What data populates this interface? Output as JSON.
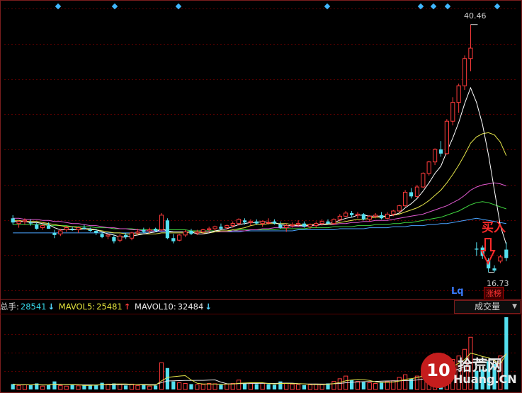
{
  "volume_header": {
    "total_label": "总手:",
    "total_value": "28541",
    "mavol5_label": "MAVOL5:",
    "mavol5_value": "25481",
    "mavol10_label": "MAVOL10:",
    "mavol10_value": "32484",
    "mode_select": "成交量"
  },
  "annotations": {
    "buy_label": "买入",
    "lq_label": "Lq",
    "zhangbang_label": "涨榜",
    "high_price": "40.46",
    "low_price": "16.73"
  },
  "watermark": {
    "logo": "10",
    "cn": "拾荒网",
    "en": "Huang.CN"
  },
  "colors": {
    "background": "#000000",
    "up_candle": "#ff3b3b",
    "down_candle": "#54e0f0",
    "grid": "#5a0000",
    "ma5": "#ffffff",
    "ma10": "#e6e64a",
    "ma20": "#e05ad0",
    "ma30": "#3fd43f",
    "ma60": "#4aa3ff"
  },
  "chart_data": [
    {
      "type": "candlestick",
      "title": "",
      "xlabel": "",
      "ylabel": "",
      "ylim": [
        15,
        42
      ],
      "grid": true,
      "x": [
        1,
        2,
        3,
        4,
        5,
        6,
        7,
        8,
        9,
        10,
        11,
        12,
        13,
        14,
        15,
        16,
        17,
        18,
        19,
        20,
        21,
        22,
        23,
        24,
        25,
        26,
        27,
        28,
        29,
        30,
        31,
        32,
        33,
        34,
        35,
        36,
        37,
        38,
        39,
        40,
        41,
        42,
        43,
        44,
        45,
        46,
        47,
        48,
        49,
        50,
        51,
        52,
        53,
        54,
        55,
        56,
        57,
        58,
        59,
        60,
        61,
        62,
        63,
        64,
        65,
        66,
        67,
        68,
        69,
        70,
        71,
        72,
        73,
        74,
        75,
        76,
        77,
        78,
        79,
        80,
        81,
        82,
        83,
        84
      ],
      "ohlc": [
        [
          21.9,
          22.2,
          21.3,
          21.5
        ],
        [
          21.4,
          21.7,
          21.0,
          21.6
        ],
        [
          21.6,
          21.9,
          21.3,
          21.7
        ],
        [
          21.5,
          21.8,
          21.2,
          21.4
        ],
        [
          21.3,
          21.5,
          20.8,
          20.9
        ],
        [
          21.0,
          21.4,
          20.8,
          21.2
        ],
        [
          21.2,
          21.5,
          20.9,
          20.9
        ],
        [
          20.5,
          20.8,
          20.0,
          20.3
        ],
        [
          20.4,
          20.9,
          20.2,
          20.7
        ],
        [
          20.8,
          21.2,
          20.6,
          21.0
        ],
        [
          20.9,
          21.1,
          20.7,
          20.8
        ],
        [
          20.8,
          21.1,
          20.5,
          21.0
        ],
        [
          21.0,
          21.3,
          20.8,
          20.9
        ],
        [
          20.8,
          21.0,
          20.6,
          20.7
        ],
        [
          20.7,
          20.9,
          20.3,
          20.5
        ],
        [
          20.4,
          20.6,
          20.0,
          20.1
        ],
        [
          20.2,
          20.4,
          19.9,
          20.3
        ],
        [
          20.1,
          20.3,
          19.5,
          19.7
        ],
        [
          19.8,
          20.4,
          19.6,
          20.2
        ],
        [
          20.3,
          20.5,
          19.9,
          20.1
        ],
        [
          20.0,
          20.6,
          19.8,
          20.5
        ],
        [
          20.5,
          20.9,
          20.3,
          20.6
        ],
        [
          20.8,
          21.0,
          20.5,
          20.6
        ],
        [
          20.7,
          21.0,
          20.5,
          20.8
        ],
        [
          20.9,
          21.0,
          20.6,
          20.7
        ],
        [
          20.8,
          22.4,
          20.7,
          22.2
        ],
        [
          21.7,
          21.9,
          19.9,
          20.0
        ],
        [
          20.0,
          20.4,
          19.5,
          19.7
        ],
        [
          19.8,
          20.4,
          19.7,
          20.3
        ],
        [
          20.3,
          20.8,
          20.1,
          20.6
        ],
        [
          20.7,
          20.9,
          20.3,
          20.4
        ],
        [
          20.5,
          20.8,
          20.3,
          20.6
        ],
        [
          20.6,
          20.9,
          20.4,
          20.8
        ],
        [
          20.8,
          21.1,
          20.6,
          20.9
        ],
        [
          20.9,
          21.2,
          20.7,
          21.1
        ],
        [
          21.1,
          21.4,
          20.8,
          20.9
        ],
        [
          21.0,
          21.3,
          20.8,
          21.2
        ],
        [
          21.2,
          21.6,
          21.0,
          21.4
        ],
        [
          21.4,
          21.9,
          21.2,
          21.8
        ],
        [
          21.7,
          21.9,
          21.3,
          21.5
        ],
        [
          21.5,
          21.8,
          21.2,
          21.6
        ],
        [
          21.6,
          21.8,
          21.3,
          21.4
        ],
        [
          21.4,
          21.7,
          21.1,
          21.6
        ],
        [
          21.5,
          21.9,
          21.3,
          21.5
        ],
        [
          21.6,
          21.8,
          21.3,
          21.4
        ],
        [
          21.3,
          21.6,
          20.9,
          21.0
        ],
        [
          21.0,
          21.4,
          20.6,
          21.2
        ],
        [
          21.2,
          21.5,
          21.0,
          21.3
        ],
        [
          21.3,
          21.7,
          21.1,
          21.4
        ],
        [
          21.4,
          21.6,
          21.0,
          21.1
        ],
        [
          21.1,
          21.4,
          20.9,
          21.3
        ],
        [
          21.2,
          21.6,
          21.0,
          21.4
        ],
        [
          21.4,
          21.8,
          21.2,
          21.6
        ],
        [
          21.6,
          21.8,
          21.3,
          21.4
        ],
        [
          21.4,
          21.9,
          21.3,
          21.8
        ],
        [
          21.8,
          22.3,
          21.6,
          22.1
        ],
        [
          22.1,
          22.6,
          22.0,
          22.4
        ],
        [
          22.4,
          22.6,
          22.0,
          22.2
        ],
        [
          22.2,
          22.5,
          21.9,
          22.3
        ],
        [
          22.3,
          22.4,
          21.7,
          21.8
        ],
        [
          21.8,
          22.2,
          21.6,
          22.1
        ],
        [
          22.1,
          22.4,
          21.9,
          22.2
        ],
        [
          22.2,
          22.5,
          21.8,
          21.9
        ],
        [
          21.9,
          22.5,
          21.8,
          22.3
        ],
        [
          22.3,
          22.7,
          22.1,
          22.6
        ],
        [
          22.6,
          23.2,
          22.5,
          23.1
        ],
        [
          23.1,
          24.6,
          23.0,
          24.4
        ],
        [
          24.4,
          24.8,
          23.8,
          24.0
        ],
        [
          24.0,
          25.1,
          23.9,
          24.9
        ],
        [
          24.9,
          26.3,
          24.8,
          26.2
        ],
        [
          26.2,
          27.4,
          26.0,
          27.3
        ],
        [
          27.3,
          28.6,
          27.0,
          28.5
        ],
        [
          28.5,
          29.3,
          27.8,
          28.1
        ],
        [
          28.1,
          31.4,
          28.0,
          31.2
        ],
        [
          31.2,
          33.5,
          30.8,
          33.0
        ],
        [
          33.0,
          34.8,
          32.0,
          34.6
        ],
        [
          34.6,
          37.5,
          34.2,
          37.2
        ],
        [
          37.2,
          40.46,
          36.0,
          38.2
        ],
        [
          19.0,
          19.6,
          18.3,
          18.9
        ],
        [
          19.1,
          19.3,
          18.0,
          18.3
        ],
        [
          17.9,
          18.1,
          16.73,
          17.1
        ],
        [
          17.1,
          17.4,
          16.73,
          16.9
        ],
        [
          17.8,
          18.4,
          17.6,
          18.2
        ],
        [
          18.9,
          19.6,
          17.8,
          18.1
        ]
      ],
      "ma5": [
        21.6,
        21.6,
        21.6,
        21.5,
        21.5,
        21.4,
        21.3,
        21.0,
        20.8,
        20.8,
        20.8,
        20.8,
        20.9,
        20.9,
        20.8,
        20.6,
        20.4,
        20.3,
        20.1,
        20.1,
        20.2,
        20.3,
        20.4,
        20.5,
        20.6,
        20.9,
        20.7,
        20.6,
        20.6,
        20.6,
        20.6,
        20.4,
        20.4,
        20.5,
        20.7,
        20.8,
        20.9,
        21.1,
        21.3,
        21.4,
        21.5,
        21.5,
        21.6,
        21.5,
        21.5,
        21.3,
        21.2,
        21.2,
        21.2,
        21.2,
        21.2,
        21.3,
        21.3,
        21.4,
        21.5,
        21.7,
        21.9,
        22.0,
        22.2,
        22.2,
        22.1,
        22.1,
        22.1,
        22.1,
        22.2,
        22.4,
        22.9,
        23.3,
        23.8,
        24.5,
        25.3,
        26.2,
        26.9,
        28.3,
        29.6,
        31.1,
        32.9,
        34.4,
        33.0,
        30.9,
        28.0,
        24.6,
        21.2,
        19.4
      ],
      "ma10": [
        21.7,
        21.7,
        21.6,
        21.6,
        21.6,
        21.5,
        21.4,
        21.3,
        21.2,
        21.1,
        21.1,
        21.0,
        20.9,
        20.8,
        20.8,
        20.7,
        20.6,
        20.5,
        20.5,
        20.4,
        20.4,
        20.4,
        20.4,
        20.4,
        20.4,
        20.5,
        20.5,
        20.5,
        20.5,
        20.5,
        20.6,
        20.6,
        20.5,
        20.5,
        20.6,
        20.7,
        20.7,
        20.8,
        20.9,
        21.0,
        21.2,
        21.3,
        21.3,
        21.4,
        21.4,
        21.4,
        21.4,
        21.3,
        21.3,
        21.3,
        21.3,
        21.3,
        21.3,
        21.3,
        21.4,
        21.5,
        21.6,
        21.7,
        21.8,
        21.8,
        21.9,
        22.0,
        22.0,
        22.1,
        22.2,
        22.3,
        22.5,
        22.7,
        22.9,
        23.2,
        23.6,
        24.1,
        24.6,
        25.3,
        26.1,
        27.0,
        28.0,
        29.1,
        29.7,
        30.0,
        30.1,
        29.9,
        29.2,
        27.9
      ],
      "ma20": [
        21.9,
        21.9,
        21.8,
        21.8,
        21.8,
        21.7,
        21.7,
        21.6,
        21.6,
        21.5,
        21.4,
        21.4,
        21.3,
        21.2,
        21.2,
        21.1,
        21.0,
        21.0,
        20.9,
        20.9,
        20.8,
        20.8,
        20.7,
        20.7,
        20.7,
        20.7,
        20.7,
        20.6,
        20.6,
        20.6,
        20.6,
        20.6,
        20.6,
        20.6,
        20.6,
        20.6,
        20.6,
        20.7,
        20.7,
        20.7,
        20.8,
        20.8,
        20.9,
        20.9,
        21.0,
        21.0,
        21.0,
        21.1,
        21.1,
        21.1,
        21.2,
        21.2,
        21.3,
        21.3,
        21.3,
        21.4,
        21.4,
        21.5,
        21.5,
        21.6,
        21.6,
        21.7,
        21.7,
        21.7,
        21.8,
        21.9,
        22.0,
        22.1,
        22.2,
        22.3,
        22.5,
        22.7,
        22.9,
        23.1,
        23.4,
        23.7,
        24.1,
        24.6,
        24.9,
        25.1,
        25.2,
        25.3,
        25.2,
        25.0
      ],
      "ma30": [
        21.3,
        21.3,
        21.3,
        21.3,
        21.3,
        21.3,
        21.2,
        21.2,
        21.2,
        21.2,
        21.1,
        21.1,
        21.1,
        21.1,
        21.0,
        21.0,
        21.0,
        20.9,
        20.9,
        20.9,
        20.9,
        20.8,
        20.8,
        20.8,
        20.8,
        20.8,
        20.8,
        20.8,
        20.8,
        20.8,
        20.7,
        20.7,
        20.7,
        20.7,
        20.7,
        20.7,
        20.7,
        20.7,
        20.8,
        20.8,
        20.8,
        20.8,
        20.8,
        20.8,
        20.8,
        20.9,
        20.9,
        20.9,
        20.9,
        20.9,
        21.0,
        21.0,
        21.0,
        21.0,
        21.1,
        21.1,
        21.1,
        21.1,
        21.2,
        21.2,
        21.2,
        21.3,
        21.3,
        21.3,
        21.4,
        21.4,
        21.5,
        21.5,
        21.6,
        21.7,
        21.8,
        21.9,
        22.0,
        22.2,
        22.4,
        22.6,
        22.9,
        23.2,
        23.4,
        23.5,
        23.4,
        23.2,
        23.0,
        22.8
      ],
      "ma60": [
        20.5,
        20.5,
        20.5,
        20.5,
        20.5,
        20.5,
        20.5,
        20.5,
        20.5,
        20.5,
        20.5,
        20.5,
        20.5,
        20.5,
        20.5,
        20.5,
        20.5,
        20.5,
        20.5,
        20.5,
        20.5,
        20.5,
        20.5,
        20.6,
        20.6,
        20.6,
        20.6,
        20.6,
        20.6,
        20.6,
        20.6,
        20.6,
        20.6,
        20.6,
        20.6,
        20.6,
        20.6,
        20.6,
        20.6,
        20.7,
        20.7,
        20.7,
        20.7,
        20.7,
        20.7,
        20.7,
        20.7,
        20.7,
        20.8,
        20.8,
        20.8,
        20.8,
        20.8,
        20.8,
        20.8,
        20.9,
        20.9,
        20.9,
        20.9,
        20.9,
        21.0,
        21.0,
        21.0,
        21.0,
        21.1,
        21.1,
        21.1,
        21.2,
        21.2,
        21.2,
        21.3,
        21.3,
        21.4,
        21.4,
        21.5,
        21.6,
        21.7,
        21.8,
        21.9,
        21.8,
        21.7,
        21.6,
        21.5,
        21.4
      ]
    },
    {
      "type": "bar",
      "title": "",
      "xlabel": "",
      "ylabel": "",
      "ylim": [
        0,
        110000
      ],
      "values": [
        8000,
        6000,
        7000,
        6500,
        9000,
        5000,
        7000,
        12000,
        6000,
        5000,
        7000,
        5500,
        6000,
        6500,
        7000,
        10000,
        8000,
        9000,
        7500,
        6000,
        8000,
        6000,
        7000,
        5000,
        6000,
        40000,
        32000,
        12000,
        10000,
        9000,
        8000,
        7000,
        7500,
        9000,
        8500,
        7000,
        8000,
        9000,
        14000,
        10000,
        9000,
        8000,
        9500,
        8000,
        7000,
        12000,
        9000,
        8000,
        7000,
        6500,
        7000,
        8000,
        7500,
        9000,
        12000,
        16000,
        20000,
        14000,
        12000,
        11000,
        10000,
        9000,
        11000,
        12000,
        13000,
        18000,
        22000,
        16000,
        20000,
        25000,
        28000,
        32000,
        30000,
        38000,
        45000,
        50000,
        60000,
        78000,
        28000,
        30000,
        42000,
        38000,
        50000,
        108000
      ],
      "up": [
        false,
        true,
        true,
        false,
        false,
        true,
        false,
        false,
        true,
        true,
        false,
        true,
        false,
        false,
        false,
        false,
        true,
        false,
        true,
        false,
        true,
        true,
        false,
        true,
        false,
        true,
        false,
        false,
        true,
        true,
        false,
        true,
        true,
        true,
        true,
        false,
        true,
        true,
        true,
        false,
        true,
        false,
        true,
        false,
        false,
        false,
        true,
        true,
        true,
        false,
        true,
        true,
        true,
        false,
        true,
        true,
        true,
        false,
        true,
        false,
        true,
        true,
        false,
        true,
        true,
        true,
        true,
        false,
        true,
        true,
        true,
        true,
        false,
        true,
        true,
        true,
        true,
        true,
        false,
        false,
        false,
        false,
        true,
        false
      ]
    }
  ]
}
